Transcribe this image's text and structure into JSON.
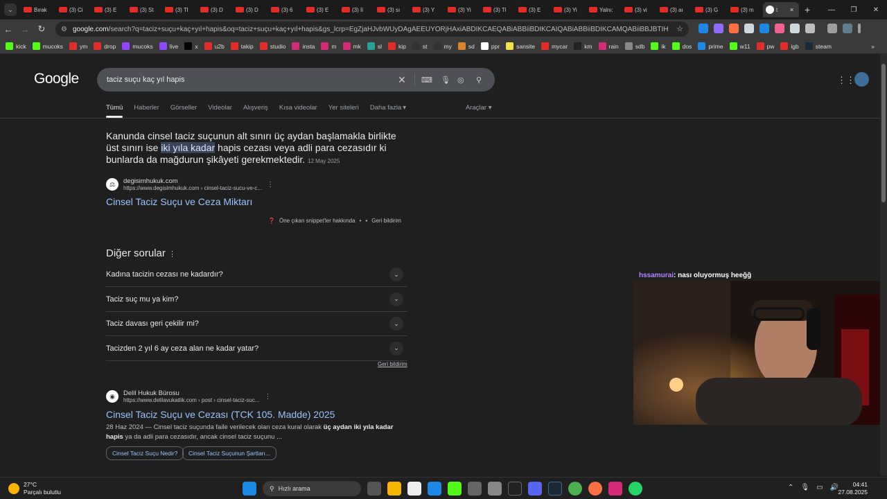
{
  "browser": {
    "tabs": [
      "Bırak",
      "(3) Ci",
      "(3) E",
      "(3) St",
      "(3) Tl",
      "(3) D",
      "(3) D",
      "(3) 6",
      "(3) E",
      "(3) İi",
      "(3) sı",
      "(3) Y",
      "(3) Yi",
      "(3) Tl",
      "(3) E",
      "(3) Yi",
      "Yalnı:",
      "(3) vi",
      "(3) aı",
      "(3) G",
      "(3) m"
    ],
    "active_tab": "t",
    "url_host": "google.com",
    "url_rest": "/search?q=taciz+suçu+kaç+yıl+hapis&oq=taciz+suçu+kaç+yıl+hapis&gs_lcrp=EgZjaHJvbWUyDAgAEEUYORjHAxiABDIKCAEQABiABBiiBDIKCAIQABiABBiiBDIKCAMQABiiBBJBTIHCAQQABjvBdIBCD...",
    "bookmarks": [
      {
        "label": "kick",
        "color": "#53fc18"
      },
      {
        "label": "mucoks",
        "color": "#53fc18"
      },
      {
        "label": "ym",
        "color": "#e52d27"
      },
      {
        "label": "drop",
        "color": "#e52d27"
      },
      {
        "label": "mucoks",
        "color": "#9146ff"
      },
      {
        "label": "live",
        "color": "#9146ff"
      },
      {
        "label": "x",
        "color": "#000000"
      },
      {
        "label": "u2b",
        "color": "#e52d27"
      },
      {
        "label": "takip",
        "color": "#e52d27"
      },
      {
        "label": "studio",
        "color": "#e52d27"
      },
      {
        "label": "insta",
        "color": "#d62976"
      },
      {
        "label": "m",
        "color": "#d62976"
      },
      {
        "label": "mk",
        "color": "#d62976"
      },
      {
        "label": "sl",
        "color": "#2aa198"
      },
      {
        "label": "kip",
        "color": "#e52d27"
      },
      {
        "label": "st",
        "color": "#333333"
      },
      {
        "label": "my",
        "color": "#333333"
      },
      {
        "label": "sd",
        "color": "#d9822b"
      },
      {
        "label": "ppr",
        "color": "#ffffff"
      },
      {
        "label": "sansite",
        "color": "#f4e04d"
      },
      {
        "label": "mycar",
        "color": "#e52d27"
      },
      {
        "label": "km",
        "color": "#222222"
      },
      {
        "label": "rain",
        "color": "#d62976"
      },
      {
        "label": "sdb",
        "color": "#888888"
      },
      {
        "label": "ik",
        "color": "#53fc18"
      },
      {
        "label": "dos",
        "color": "#53fc18"
      },
      {
        "label": "prime",
        "color": "#1e88e5"
      },
      {
        "label": "w11",
        "color": "#53fc18"
      },
      {
        "label": "pw",
        "color": "#e52d27"
      },
      {
        "label": "igb",
        "color": "#e52d27"
      },
      {
        "label": "steam",
        "color": "#1b2838"
      }
    ]
  },
  "google": {
    "logo": "Google",
    "query": "taciz suçu kaç yıl hapis",
    "tabs": [
      "Tümü",
      "Haberler",
      "Görseller",
      "Videolar",
      "Alışveriş",
      "Kısa videolar",
      "Yer siteleri",
      "Daha fazla"
    ],
    "tools": "Araçlar",
    "featured": {
      "text_before": "Kanunda cinsel taciz suçunun alt sınırı üç aydan başlamakla birlikte üst sınırı ise ",
      "highlight": "iki yıla kadar",
      "text_after": " hapis cezası veya adli para cezasıdır ki bunlarda da mağdurun şikâyeti gerekmektedir.",
      "date": "12 May 2025",
      "site": "degisimhukuk.com",
      "url": "https://www.degisimhukuk.com › cinsel-taciz-sucu-ve-c...",
      "title": "Cinsel Taciz Suçu ve Ceza Miktarı",
      "about": "Öne çıkan snippet'ler hakkında",
      "feedback": "Geri bildirim"
    },
    "paa": {
      "heading": "Diğer sorular",
      "questions": [
        "Kadına tacizin cezası ne kadardır?",
        "Taciz suç mu ya kim?",
        "Taciz davası geri çekilir mi?",
        "Tacizden 2 yıl 6 ay ceza alan ne kadar yatar?"
      ],
      "feedback": "Geri bildirim"
    },
    "result2": {
      "site": "Delil Hukuk Bürosu",
      "url": "https://www.delilavukatlik.com › post › cinsel-taciz-suc...",
      "title": "Cinsel Taciz Suçu ve Cezası (TCK 105. Madde) 2025",
      "date": "28 Haz 2024",
      "snippet_a": " — Cinsel taciz suçunda faile verilecek olan ceza kural olarak ",
      "snippet_bold": "üç aydan iki yıla kadar hapis",
      "snippet_b": " ya da adli para cezasıdır, ancak cinsel taciz suçunu ...",
      "chips": [
        "Cinsel Taciz Suçu Nedir?",
        "Cinsel Taciz Suçunun Şartları..."
      ]
    }
  },
  "stream": {
    "chat_user": "hssamurai",
    "chat_msg": ": nası oluyormuş heeğğ"
  },
  "taskbar": {
    "temp": "27°C",
    "weather": "Parçalı bulutlu",
    "search": "Hızlı arama",
    "time": "04:41",
    "date": "27.08.2025"
  }
}
